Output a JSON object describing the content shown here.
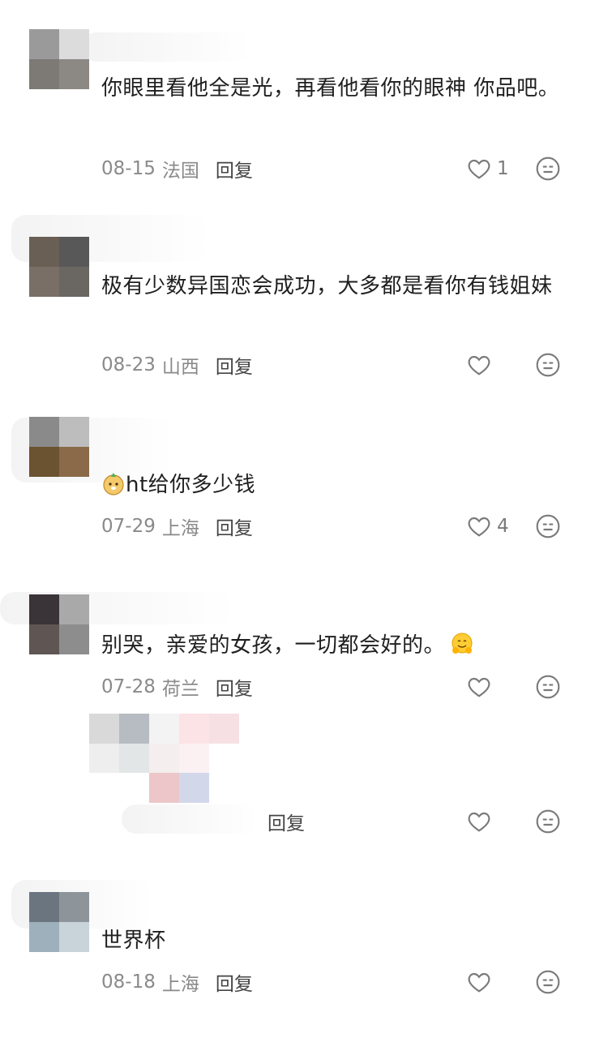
{
  "comments": [
    {
      "text": "你眼里看他全是光，再看他看你的眼神 你品吧。",
      "date": "08-15",
      "location": "法国",
      "reply": "回复",
      "likes": "1"
    },
    {
      "text": "极有少数异国恋会成功，大多都是看你有钱姐妹",
      "date": "08-23",
      "location": "山西",
      "reply": "回复",
      "likes": ""
    },
    {
      "text": "ht给你多少钱",
      "date": "07-29",
      "location": "上海",
      "reply": "回复",
      "likes": "4"
    },
    {
      "text": "别哭，亲爱的女孩，一切都会好的。",
      "date": "07-28",
      "location": "荷兰",
      "reply": "回复",
      "likes": ""
    },
    {
      "text": "",
      "date": "",
      "location": "",
      "reply": "回复",
      "likes": ""
    },
    {
      "text": "世界杯",
      "date": "08-18",
      "location": "上海",
      "reply": "回复",
      "likes": ""
    }
  ],
  "icons": {
    "like": "heart-outline-icon",
    "dislike": "neutral-face-icon"
  },
  "colors": {
    "text": "#1f1f1f",
    "meta": "#8a8a8a",
    "icon": "#7a7a7a"
  }
}
